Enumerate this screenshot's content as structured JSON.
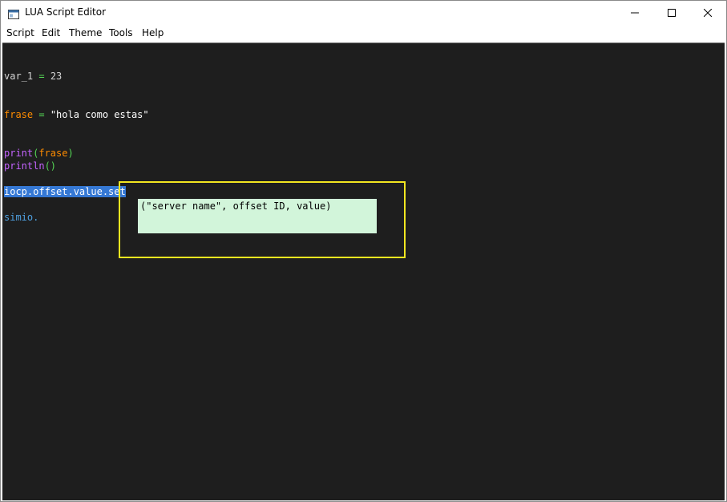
{
  "window": {
    "title": "LUA Script Editor"
  },
  "menu": {
    "items": [
      "Script",
      "Edit",
      "Theme",
      "Tools",
      "Help"
    ]
  },
  "colors": {
    "editor_bg": "#1e1e1e",
    "variable": "#ff8c00",
    "keyword": "#c464ff",
    "number": "#55d655",
    "operator": "#55d655",
    "string": "#ffffff",
    "paren": "#55d655",
    "member": "#4fa0e0",
    "selection": "#3578d4",
    "tooltip_bg": "#d2f5da",
    "highlight_frame": "#f3e620"
  },
  "code": {
    "line1": {
      "name": "var_1",
      "op": " = ",
      "value": "23"
    },
    "line2": {
      "name": "frase",
      "op": " = ",
      "value": "\"hola como estas\""
    },
    "line3": {
      "fn": "print",
      "open": "(",
      "arg": "frase",
      "close": ")"
    },
    "line4": {
      "fn": "println",
      "parens": "()"
    },
    "line5": {
      "selected": "iocp.offset.value.set"
    },
    "line6": {
      "text": "simio."
    }
  },
  "tooltip": {
    "text": "(\"server name\", offset ID, value)"
  }
}
